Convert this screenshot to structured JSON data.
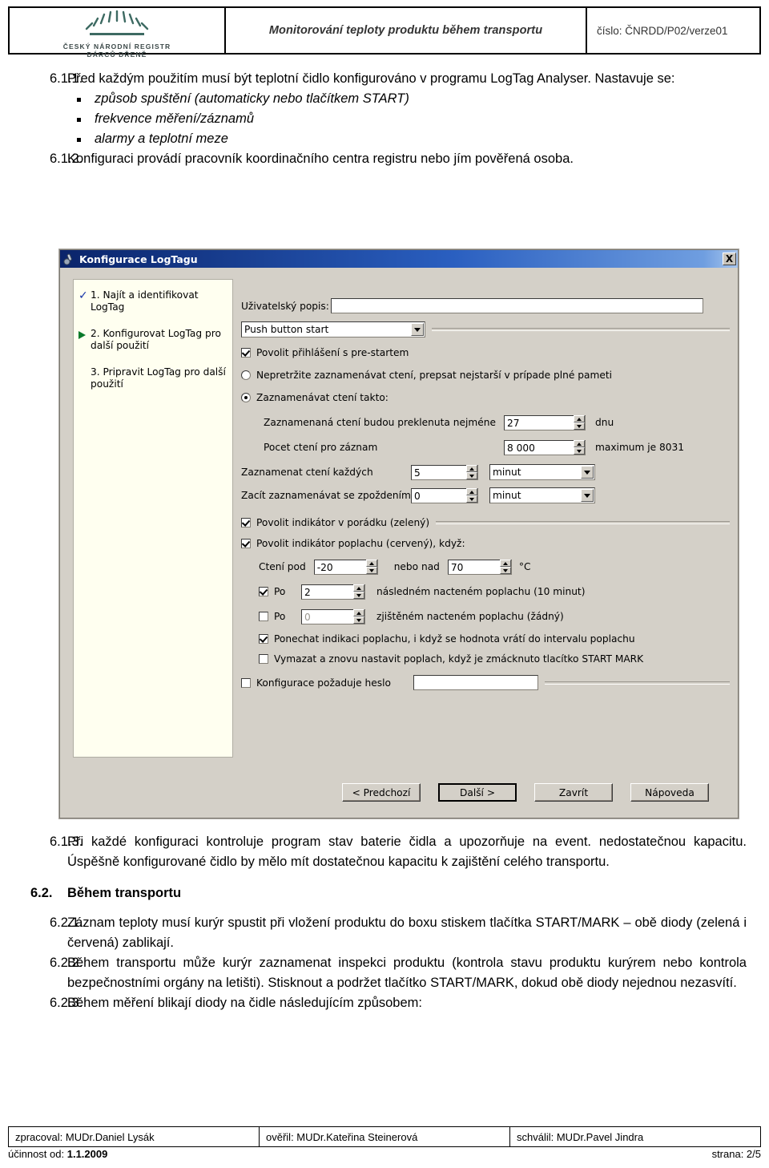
{
  "header": {
    "logo_line1": "ČESKÝ NÁRODNÍ REGISTR",
    "logo_line2": "DÁRCŮ DŘENĚ",
    "logo_icon": "sunburst-rays-icon",
    "title": "Monitorování teploty produktu během transportu",
    "document_number": "číslo: ČNRDD/P02/verze01"
  },
  "content": {
    "items": [
      {
        "num": "6.1.1.",
        "text": "Před každým použitím musí být teplotní čidlo konfigurováno v programu LogTag Analyser. Nastavuje se:"
      },
      {
        "num": "6.1.2.",
        "text": "Konfiguraci provádí pracovník koordinačního centra registru nebo jím pověřená osoba."
      },
      {
        "num": "6.1.3.",
        "text": "Při každé konfiguraci kontroluje program stav baterie čidla a upozorňuje na event. nedostatečnou kapacitu. Úspěšně konfigurované čidlo by mělo mít dostatečnou kapacitu k zajištění celého transportu."
      }
    ],
    "bullets": [
      "způsob spuštění (automaticky nebo tlačítkem START)",
      "frekvence měření/záznamů",
      "alarmy a teplotní meze"
    ],
    "section": {
      "num": "6.2.",
      "title": "Během transportu"
    },
    "items2": [
      {
        "num": "6.2.1.",
        "text": "Záznam teploty musí kurýr spustit při vložení produktu do boxu stiskem tlačítka START/MARK – obě diody (zelená i červená) zablikají."
      },
      {
        "num": "6.2.2.",
        "text": "Během transportu může kurýr zaznamenat inspekci produktu (kontrola stavu produktu kurýrem nebo kontrola bezpečnostními orgány na letišti). Stisknout a podržet tlačítko START/MARK, dokud obě diody nejednou nezasvítí."
      },
      {
        "num": "6.2.3.",
        "text": "Během měření blikají diody na čidle následujícím způsobem:"
      }
    ]
  },
  "dialog": {
    "title": "Konfigurace LogTagu",
    "title_icon": "logtag-device-icon",
    "close_label": "X",
    "sidebar": [
      {
        "mark": "check",
        "label": "1. Najít a identifikovat LogTag"
      },
      {
        "mark": "arrow",
        "label": "2. Konfigurovat LogTag pro další použití"
      },
      {
        "mark": "none",
        "label": "3. Pripravit LogTag pro další použití"
      }
    ],
    "desc_label": "Uživatelský popis:",
    "desc_value": "",
    "start_mode": "Push button start",
    "prestart_label": "Povolit přihlášení s pre-startem",
    "prestart_checked": true,
    "radio_continuous": "Nepretržite zaznamenávat ctení, prepsat nejstarší v prípade plné pameti",
    "radio_custom": "Zaznamenávat ctení takto:",
    "radio_selected": "custom",
    "span_label": "Zaznamenaná ctení budou preklenuta nejméne",
    "span_value": "27",
    "span_unit": "dnu",
    "count_label": "Pocet ctení pro záznam",
    "count_value": "8 000",
    "count_hint": "maximum je 8031",
    "every_label": "Zaznamenat ctení každých",
    "every_value": "5",
    "every_unit": "minut",
    "delay_label": "Zacít zaznamenávat se zpoždením",
    "delay_value": "0",
    "delay_unit": "minut",
    "ok_indicator_label": "Povolit indikátor v porádku (zelený)",
    "ok_indicator_checked": true,
    "alarm_indicator_label": "Povolit indikátor poplachu (cervený), když:",
    "alarm_indicator_checked": true,
    "reading_below_label": "Ctení pod",
    "reading_below_value": "-20",
    "reading_above_label": "nebo nad",
    "reading_above_value": "70",
    "temp_unit": "°C",
    "after_label_1": "Po",
    "after_value_1": "2",
    "after_text_1": "následném nacteném poplachu (10 minut)",
    "after_checked_1": true,
    "after_label_2": "Po",
    "after_value_2": "0",
    "after_text_2": "zjištěném nacteném poplachu (žádný)",
    "after_checked_2": false,
    "keep_alarm_label": "Ponechat indikaci poplachu, i když se hodnota vrátí do intervalu poplachu",
    "keep_alarm_checked": true,
    "clear_alarm_label": "Vymazat a znovu nastavit poplach, když je zmácknuto tlacítko START MARK",
    "clear_alarm_checked": false,
    "password_label": "Konfigurace požaduje heslo",
    "password_checked": false,
    "password_value": "",
    "buttons": {
      "prev": "< Predchozí",
      "next": "Další  >",
      "close": "Zavrít",
      "help": "Nápoveda"
    }
  },
  "footer": {
    "cells": [
      "zpracoval: MUDr.Daniel Lysák",
      "ověřil: MUDr.Kateřina Steinerová",
      "schválil: MUDr.Pavel Jindra"
    ],
    "validity_label": "účinnost od:",
    "validity_value": "1.1.2009",
    "page": "strana: 2/5"
  }
}
